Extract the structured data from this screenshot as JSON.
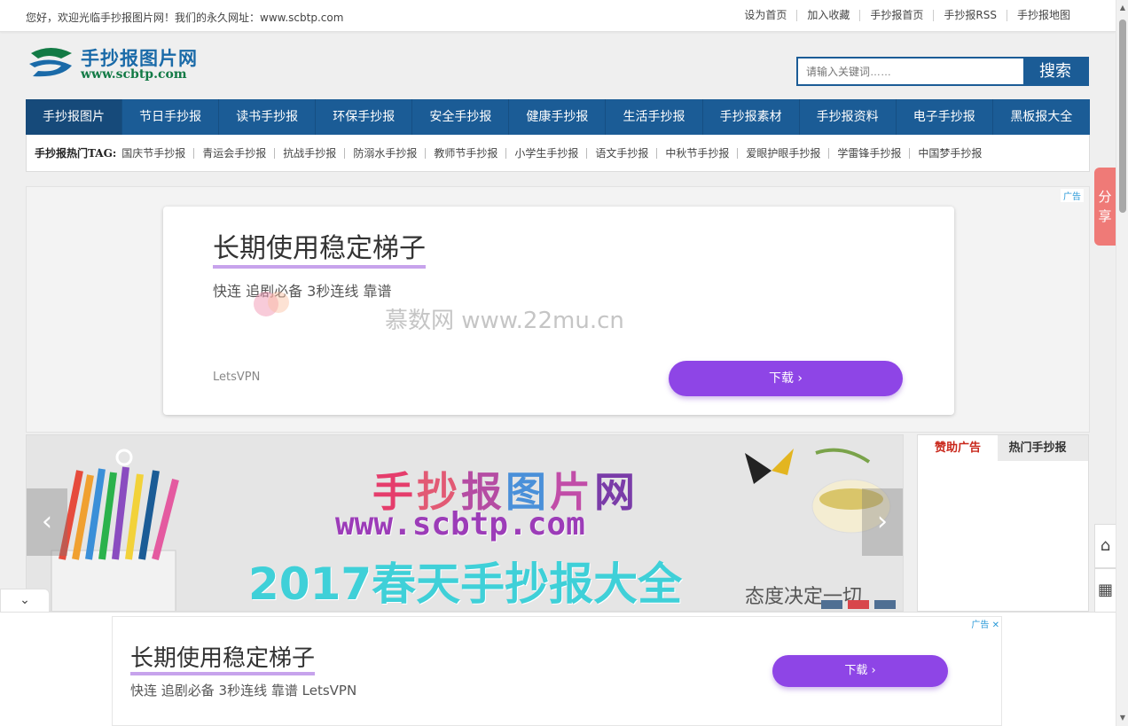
{
  "topbar": {
    "welcome": "您好，欢迎光临手抄报图片网！我们的永久网址：www.scbtp.com",
    "links": [
      "设为首页",
      "加入收藏",
      "手抄报首页",
      "手抄报RSS",
      "手抄报地图"
    ]
  },
  "logo": {
    "cn": "手抄报图片网",
    "en": "www.scbtp.com"
  },
  "search": {
    "placeholder": "请输入关键词……",
    "button": "搜索"
  },
  "nav": [
    "手抄报图片",
    "节日手抄报",
    "读书手抄报",
    "环保手抄报",
    "安全手抄报",
    "健康手抄报",
    "生活手抄报",
    "手抄报素材",
    "手抄报资料",
    "电子手抄报",
    "黑板报大全"
  ],
  "tags": {
    "label": "手抄报热门TAG:",
    "items": [
      "国庆节手抄报",
      "青运会手抄报",
      "抗战手抄报",
      "防溺水手抄报",
      "教师节手抄报",
      "小学生手抄报",
      "语文手抄报",
      "中秋节手抄报",
      "爱眼护眼手抄报",
      "学雷锋手抄报",
      "中国梦手抄报"
    ]
  },
  "ad": {
    "tag": "广告",
    "title": "长期使用稳定梯子",
    "subtitle": "快连 追剧必备 3秒连线 靠谱",
    "brand": "LetsVPN",
    "download": "下载",
    "watermark": "慕数网 www.22mu.cn"
  },
  "banner": {
    "chars": [
      "手",
      "抄",
      "报",
      "图",
      "片",
      "网"
    ],
    "url": "www.scbtp.com",
    "headline": "2017春天手抄报大全",
    "motto": "态度决定一切"
  },
  "side": {
    "tabs": [
      "赞助广告",
      "热门手抄报"
    ]
  },
  "bottomad": {
    "tag": "广告",
    "title": "长期使用稳定梯子",
    "subtitle": "快连 追剧必备 3秒连线 靠谱 LetsVPN",
    "download": "下载"
  },
  "share": "分享",
  "colors": {
    "nav": "#1b5c96",
    "accent_purple": "#8e45e6",
    "share": "#ef7a77"
  }
}
